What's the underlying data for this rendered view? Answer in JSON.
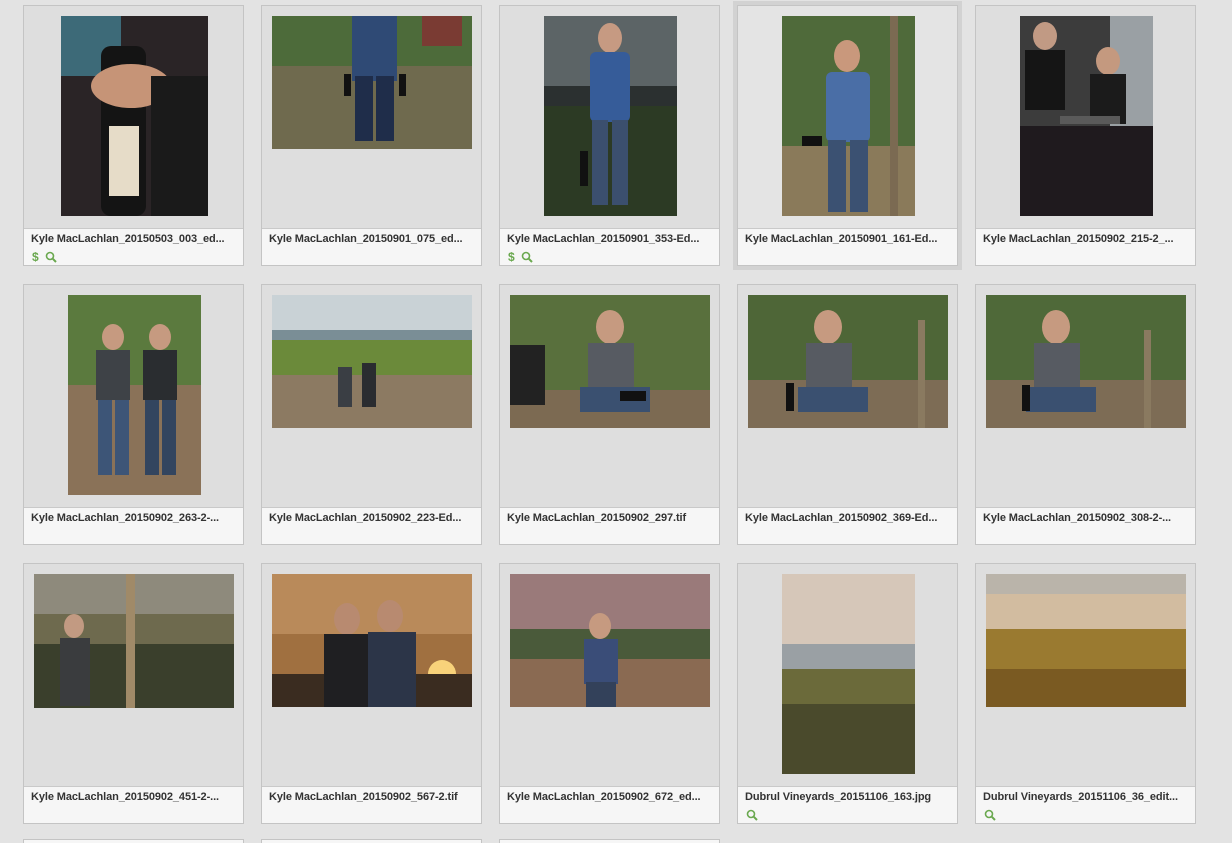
{
  "colors": {
    "accent": "#6aa84f",
    "tile_bg": "#dedede",
    "page_bg": "#e3e3e3"
  },
  "items": [
    {
      "filename": "Kyle MacLachlan_20150503_003_ed...",
      "icons": [
        "dollar-icon",
        "zoom-icon"
      ],
      "selected": false,
      "orientation": "portrait"
    },
    {
      "filename": "Kyle MacLachlan_20150901_075_ed...",
      "icons": [],
      "selected": false,
      "orientation": "landscape"
    },
    {
      "filename": "Kyle MacLachlan_20150901_353-Ed...",
      "icons": [
        "dollar-icon",
        "zoom-icon"
      ],
      "selected": false,
      "orientation": "portrait"
    },
    {
      "filename": "Kyle MacLachlan_20150901_161-Ed...",
      "icons": [],
      "selected": true,
      "orientation": "portrait"
    },
    {
      "filename": "Kyle MacLachlan_20150902_215-2_...",
      "icons": [],
      "selected": false,
      "orientation": "portrait"
    },
    {
      "filename": "Kyle MacLachlan_20150902_263-2-...",
      "icons": [],
      "selected": false,
      "orientation": "portrait"
    },
    {
      "filename": "Kyle MacLachlan_20150902_223-Ed...",
      "icons": [],
      "selected": false,
      "orientation": "landscape"
    },
    {
      "filename": "Kyle MacLachlan_20150902_297.tif",
      "icons": [],
      "selected": false,
      "orientation": "landscape"
    },
    {
      "filename": "Kyle MacLachlan_20150902_369-Ed...",
      "icons": [],
      "selected": false,
      "orientation": "landscape"
    },
    {
      "filename": "Kyle MacLachlan_20150902_308-2-...",
      "icons": [],
      "selected": false,
      "orientation": "landscape"
    },
    {
      "filename": "Kyle MacLachlan_20150902_451-2-...",
      "icons": [],
      "selected": false,
      "orientation": "landscape"
    },
    {
      "filename": "Kyle MacLachlan_20150902_567-2.tif",
      "icons": [],
      "selected": false,
      "orientation": "landscape"
    },
    {
      "filename": "Kyle MacLachlan_20150902_672_ed...",
      "icons": [],
      "selected": false,
      "orientation": "landscape"
    },
    {
      "filename": "Dubrul Vineyards_20151106_163.jpg",
      "icons": [
        "zoom-icon"
      ],
      "selected": false,
      "orientation": "portrait"
    },
    {
      "filename": "Dubrul Vineyards_20151106_36_edit...",
      "icons": [
        "zoom-icon"
      ],
      "selected": false,
      "orientation": "landscape"
    }
  ]
}
